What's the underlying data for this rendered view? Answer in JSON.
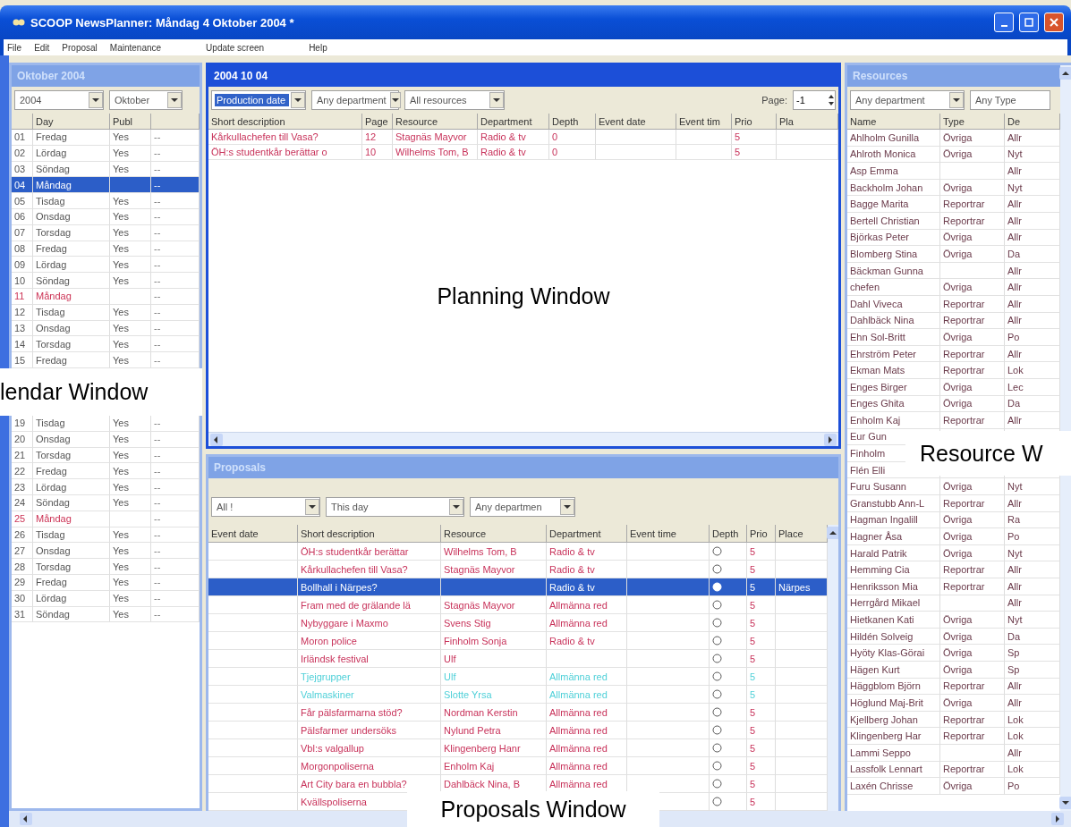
{
  "window": {
    "title": "SCOOP NewsPlanner: Måndag 4 Oktober 2004  *"
  },
  "menu": [
    "File",
    "Edit",
    "Proposal",
    "Maintenance",
    "Update screen",
    "Help"
  ],
  "calendar": {
    "title": "Oktober 2004",
    "active": false,
    "year": "2004",
    "month": "Oktober",
    "columns": [
      "Day",
      "Publ"
    ],
    "rows_top": [
      {
        "num": "01",
        "day": "Fredag",
        "publ": "Yes",
        "mark": "--",
        "color": "#555555",
        "selected": false
      },
      {
        "num": "02",
        "day": "Lördag",
        "publ": "Yes",
        "mark": "--",
        "color": "#555555",
        "selected": false
      },
      {
        "num": "03",
        "day": "Söndag",
        "publ": "Yes",
        "mark": "--",
        "color": "#555555",
        "selected": false
      },
      {
        "num": "04",
        "day": "Måndag",
        "mark": "--",
        "selected": true
      },
      {
        "num": "05",
        "day": "Tisdag",
        "publ": "Yes",
        "mark": "--",
        "color": "#555555",
        "selected": false
      },
      {
        "num": "06",
        "day": "Onsdag",
        "publ": "Yes",
        "mark": "--",
        "color": "#555555",
        "selected": false
      },
      {
        "num": "07",
        "day": "Torsdag",
        "publ": "Yes",
        "mark": "--",
        "color": "#555555",
        "selected": false
      },
      {
        "num": "08",
        "day": "Fredag",
        "publ": "Yes",
        "mark": "--",
        "color": "#555555",
        "selected": false
      },
      {
        "num": "09",
        "day": "Lördag",
        "publ": "Yes",
        "mark": "--",
        "color": "#555555",
        "selected": false
      },
      {
        "num": "10",
        "day": "Söndag",
        "publ": "Yes",
        "mark": "--",
        "color": "#555555",
        "selected": false
      },
      {
        "num": "11",
        "day": "Måndag",
        "mark": "--",
        "color": "#cc3355",
        "selected": false
      },
      {
        "num": "12",
        "day": "Tisdag",
        "publ": "Yes",
        "mark": "--",
        "color": "#555555",
        "selected": false
      },
      {
        "num": "13",
        "day": "Onsdag",
        "publ": "Yes",
        "mark": "--",
        "color": "#555555",
        "selected": false
      },
      {
        "num": "14",
        "day": "Torsdag",
        "publ": "Yes",
        "mark": "--",
        "color": "#555555",
        "selected": false
      },
      {
        "num": "15",
        "day": "Fredag",
        "publ": "Yes",
        "mark": "--",
        "color": "#555555",
        "selected": false
      }
    ],
    "callout": "lendar Window",
    "rows_bottom": [
      {
        "num": "19",
        "day": "Tisdag",
        "publ": "Yes",
        "mark": "--",
        "color": "#555555",
        "selected": false
      },
      {
        "num": "20",
        "day": "Onsdag",
        "publ": "Yes",
        "mark": "--",
        "color": "#555555",
        "selected": false
      },
      {
        "num": "21",
        "day": "Torsdag",
        "publ": "Yes",
        "mark": "--",
        "color": "#555555",
        "selected": false
      },
      {
        "num": "22",
        "day": "Fredag",
        "publ": "Yes",
        "mark": "--",
        "color": "#555555",
        "selected": false
      },
      {
        "num": "23",
        "day": "Lördag",
        "publ": "Yes",
        "mark": "--",
        "color": "#555555",
        "selected": false
      },
      {
        "num": "24",
        "day": "Söndag",
        "publ": "Yes",
        "mark": "--",
        "color": "#555555",
        "selected": false
      },
      {
        "num": "25",
        "day": "Måndag",
        "mark": "--",
        "color": "#cc3355",
        "selected": false
      },
      {
        "num": "26",
        "day": "Tisdag",
        "publ": "Yes",
        "mark": "--",
        "color": "#555555",
        "selected": false
      },
      {
        "num": "27",
        "day": "Onsdag",
        "publ": "Yes",
        "mark": "--",
        "color": "#555555",
        "selected": false
      },
      {
        "num": "28",
        "day": "Torsdag",
        "publ": "Yes",
        "mark": "--",
        "color": "#555555",
        "selected": false
      },
      {
        "num": "29",
        "day": "Fredag",
        "publ": "Yes",
        "mark": "--",
        "color": "#555555",
        "selected": false
      },
      {
        "num": "30",
        "day": "Lördag",
        "publ": "Yes",
        "mark": "--",
        "color": "#555555",
        "selected": false
      },
      {
        "num": "31",
        "day": "Söndag",
        "publ": "Yes",
        "mark": "--",
        "color": "#555555",
        "selected": false
      }
    ]
  },
  "planning": {
    "title": "2004 10 04",
    "active": true,
    "filters": [
      {
        "value": "Production date",
        "highlighted": true
      },
      {
        "value": "Any department",
        "highlighted": false
      },
      {
        "value": "All resources",
        "highlighted": false
      }
    ],
    "page_label": "Page:",
    "page": "-1",
    "columns": [
      "Short description",
      "Page",
      "Resource",
      "Department",
      "Depth",
      "Event date",
      "Event tim",
      "Prio",
      "Pla"
    ],
    "rows": [
      [
        "Kårkullachefen till Vasa?",
        "12",
        "Stagnäs Mayvor",
        "Radio & tv",
        "0",
        "",
        "",
        "5",
        ""
      ],
      [
        "ÖH:s studentkår berättar o",
        "10",
        "Wilhelms Tom, B",
        "Radio & tv",
        "0",
        "",
        "",
        "5",
        ""
      ]
    ],
    "callout": "Planning Window"
  },
  "proposals": {
    "title": "Proposals",
    "active": false,
    "filters": [
      "All !",
      "This day",
      "Any departmen"
    ],
    "columns": [
      "Event date",
      "Short description",
      "Resource",
      "Department",
      "Event time",
      "Depth",
      "Prio",
      "Place"
    ],
    "rows": [
      {
        "description": "ÖH:s studentkår berättar",
        "resource": "Wilhelms Tom, B",
        "department": "Radio & tv",
        "prio": "5",
        "color": "#c8325a",
        "selected": false
      },
      {
        "description": "Kårkullachefen till Vasa?",
        "resource": "Stagnäs Mayvor",
        "department": "Radio & tv",
        "prio": "5",
        "color": "#c8325a",
        "selected": false
      },
      {
        "description": "Bollhall i Närpes?",
        "department": "Radio & tv",
        "prio": "5",
        "place": "Närpes",
        "selected": true
      },
      {
        "description": "Fram med de grälande lä",
        "resource": "Stagnäs Mayvor",
        "department": "Allmänna red",
        "prio": "5",
        "color": "#c8325a",
        "selected": false
      },
      {
        "description": "Nybyggare i Maxmo",
        "resource": "Svens Stig",
        "department": "Allmänna red",
        "prio": "5",
        "color": "#c8325a",
        "selected": false
      },
      {
        "description": "Moron police",
        "resource": "Finholm Sonja",
        "department": "Radio & tv",
        "prio": "5",
        "color": "#c8325a",
        "selected": false
      },
      {
        "description": "Irländsk festival",
        "resource": "Ulf",
        "prio": "5",
        "color": "#c8325a",
        "selected": false
      },
      {
        "description": "Tjejgrupper",
        "resource": "Ulf",
        "department": "Allmänna red",
        "prio": "5",
        "color": "#4fd0d8",
        "selected": false
      },
      {
        "description": "Valmaskiner",
        "resource": "Slotte Yrsa",
        "department": "Allmänna red",
        "prio": "5",
        "color": "#4fd0d8",
        "selected": false
      },
      {
        "description": "Får pälsfarmarna stöd?",
        "resource": "Nordman Kerstin",
        "department": "Allmänna red",
        "prio": "5",
        "color": "#c8325a",
        "selected": false
      },
      {
        "description": "Pälsfarmer undersöks",
        "resource": "Nylund Petra",
        "department": "Allmänna red",
        "prio": "5",
        "color": "#c8325a",
        "selected": false
      },
      {
        "description": "Vbl:s valgallup",
        "resource": "Klingenberg Hanr",
        "department": "Allmänna red",
        "prio": "5",
        "color": "#c8325a",
        "selected": false
      },
      {
        "description": "Morgonpoliserna",
        "resource": "Enholm Kaj",
        "department": "Allmänna red",
        "prio": "5",
        "color": "#c8325a",
        "selected": false
      },
      {
        "description": "Art City bara en bubbla?",
        "resource": "Dahlbäck Nina, B",
        "department": "Allmänna red",
        "prio": "5",
        "color": "#c8325a",
        "selected": false
      },
      {
        "description": "Kvällspoliserna",
        "prio": "5",
        "color": "#c8325a",
        "selected": false
      }
    ],
    "callout": "Proposals Window"
  },
  "resources": {
    "title": "Resources",
    "active": false,
    "filters": [
      "Any department",
      "Any Type"
    ],
    "columns": [
      "Name",
      "Type",
      "De"
    ],
    "rows": [
      [
        "Ahlholm Gunilla",
        "Övriga",
        "Allr"
      ],
      [
        "Ahlroth Monica",
        "Övriga",
        "Nyt"
      ],
      [
        "Asp Emma",
        "",
        "Allr"
      ],
      [
        "Backholm Johan",
        "Övriga",
        "Nyt"
      ],
      [
        "Bagge Marita",
        "Reportrar",
        "Allr"
      ],
      [
        "Bertell Christian",
        "Reportrar",
        "Allr"
      ],
      [
        "Björkas Peter",
        "Övriga",
        "Allr"
      ],
      [
        "Blomberg Stina",
        "Övriga",
        "Da"
      ],
      [
        "Bäckman Gunna",
        "",
        "Allr"
      ],
      [
        "chefen",
        "Övriga",
        "Allr"
      ],
      [
        "Dahl Viveca",
        "Reportrar",
        "Allr"
      ],
      [
        "Dahlbäck Nina",
        "Reportrar",
        "Allr"
      ],
      [
        "Ehn Sol-Britt",
        "Övriga",
        "Po"
      ],
      [
        "Ehrström Peter",
        "Reportrar",
        "Allr"
      ],
      [
        "Ekman Mats",
        "Reportrar",
        "Lok"
      ],
      [
        "Enges Birger",
        "Övriga",
        "Lec"
      ],
      [
        "Enges Ghita",
        "Övriga",
        "Da"
      ],
      [
        "Enholm Kaj",
        "Reportrar",
        "Allr"
      ],
      [
        "Eur Gun",
        "",
        ""
      ],
      [
        "Finholm",
        "",
        ""
      ],
      [
        "Flén Elli",
        "",
        ""
      ],
      [
        "Furu Susann",
        "Övriga",
        "Nyt"
      ],
      [
        "Granstubb Ann-L",
        "Reportrar",
        "Allr"
      ],
      [
        "Hagman Ingalill",
        "Övriga",
        "Ra"
      ],
      [
        "Hagner Åsa",
        "Övriga",
        "Po"
      ],
      [
        "Harald Patrik",
        "Övriga",
        "Nyt"
      ],
      [
        "Hemming Cia",
        "Reportrar",
        "Allr"
      ],
      [
        "Henriksson Mia",
        "Reportrar",
        "Allr"
      ],
      [
        "Herrgård Mikael",
        "",
        "Allr"
      ],
      [
        "Hietkanen Kati",
        "Övriga",
        "Nyt"
      ],
      [
        "Hildén Solveig",
        "Övriga",
        "Da"
      ],
      [
        "Hyöty Klas-Görai",
        "Övriga",
        "Sp"
      ],
      [
        "Hägen Kurt",
        "Övriga",
        "Sp"
      ],
      [
        "Häggblom Björn",
        "Reportrar",
        "Allr"
      ],
      [
        "Höglund Maj-Brit",
        "Övriga",
        "Allr"
      ],
      [
        "Kjellberg Johan",
        "Reportrar",
        "Lok"
      ],
      [
        "Klingenberg Har",
        "Reportrar",
        "Lok"
      ],
      [
        "Lammi Seppo",
        "",
        "Allr"
      ],
      [
        "Lassfolk Lennart",
        "Reportrar",
        "Lok"
      ],
      [
        "Laxén Chrisse",
        "Övriga",
        "Po"
      ]
    ],
    "callout": "Resource W"
  }
}
